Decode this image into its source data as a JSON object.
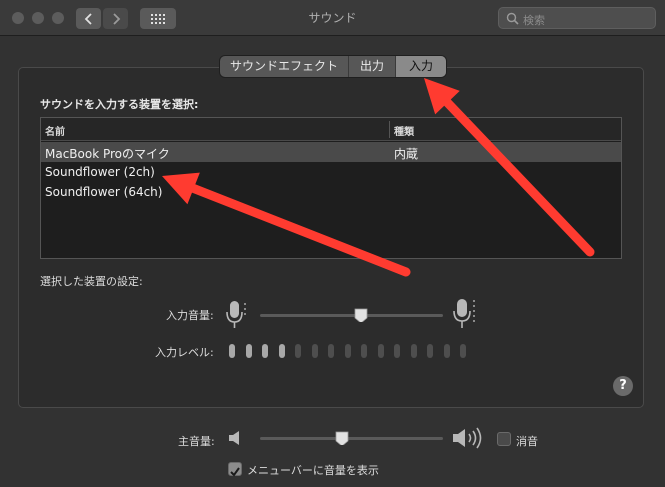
{
  "window": {
    "title": "サウンド"
  },
  "search": {
    "placeholder": "検索"
  },
  "tabs": [
    {
      "label": "サウンドエフェクト"
    },
    {
      "label": "出力"
    },
    {
      "label": "入力",
      "active": true
    }
  ],
  "input": {
    "heading": "サウンドを入力する装置を選択:",
    "columns": {
      "name": "名前",
      "type": "種類"
    },
    "devices": [
      {
        "name": "MacBook Proのマイク",
        "type": "内蔵",
        "selected": true
      },
      {
        "name": "Soundflower (2ch)",
        "type": ""
      },
      {
        "name": "Soundflower (64ch)",
        "type": ""
      }
    ],
    "settings_heading": "選択した装置の設定:",
    "volume_label": "入力音量:",
    "volume_value": 0.55,
    "level_label": "入力レベル:",
    "level_total": 15,
    "level_active": 4
  },
  "output": {
    "volume_label": "主音量:",
    "volume_value": 0.45,
    "mute_label": "消音",
    "mute_checked": false,
    "menubar_label": "メニューバーに音量を表示",
    "menubar_checked": true
  },
  "help": {
    "label": "?"
  },
  "colors": {
    "annotation_arrow": "#ff3b30",
    "accent": "#8a8a8a"
  }
}
